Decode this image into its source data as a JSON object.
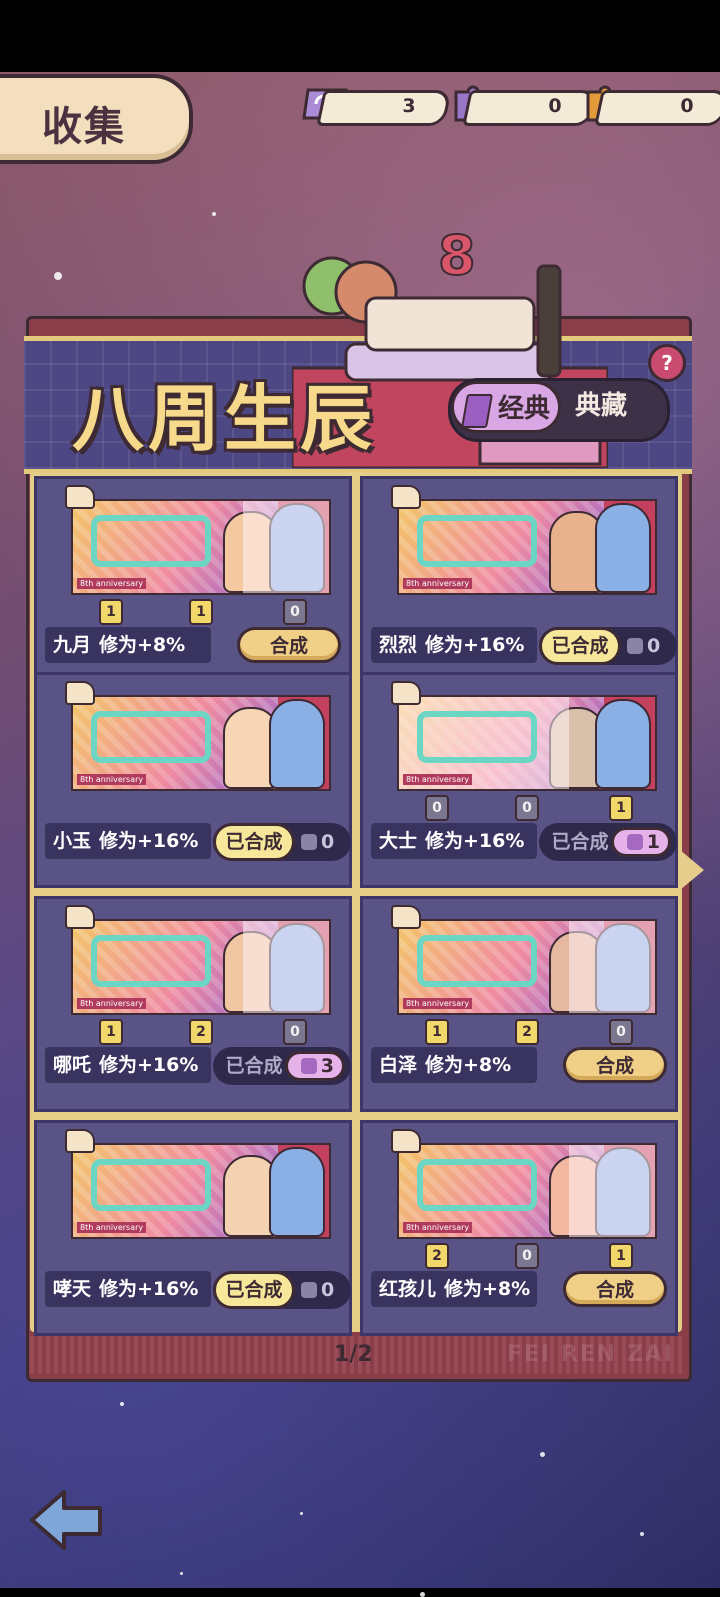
{
  "header": {
    "title": "收集",
    "currencies": [
      {
        "icon": "ticket-icon",
        "value": "3",
        "color": "#a98bd6"
      },
      {
        "icon": "purple-puzzle-icon",
        "value": "0",
        "color": "#9a76c9"
      },
      {
        "icon": "orange-puzzle-icon",
        "value": "0",
        "color": "#e39a3a"
      }
    ]
  },
  "banner": {
    "title": "八周生辰",
    "tabs": {
      "classic": "经典",
      "collection": "典藏"
    },
    "help": "?"
  },
  "cards": [
    {
      "name": "九月",
      "bonus": "修为+8%",
      "pieces": [
        "1",
        "1",
        "0"
      ],
      "state": "compose",
      "action": "合成"
    },
    {
      "name": "烈烈",
      "bonus": "修为+16%",
      "pieces": [],
      "state": "done",
      "action": "已合成",
      "fragments": "0"
    },
    {
      "name": "小玉",
      "bonus": "修为+16%",
      "pieces": [],
      "state": "done",
      "action": "已合成",
      "fragments": "0"
    },
    {
      "name": "大士",
      "bonus": "修为+16%",
      "pieces": [
        "0",
        "0",
        "1"
      ],
      "state": "done-dim",
      "action": "已合成",
      "fragments": "1"
    },
    {
      "name": "哪吒",
      "bonus": "修为+16%",
      "pieces": [
        "1",
        "2",
        "0"
      ],
      "state": "done-dim",
      "action": "已合成",
      "fragments": "3"
    },
    {
      "name": "白泽",
      "bonus": "修为+8%",
      "pieces": [
        "1",
        "2",
        "0"
      ],
      "state": "compose",
      "action": "合成"
    },
    {
      "name": "哮天",
      "bonus": "修为+16%",
      "pieces": [],
      "state": "done",
      "action": "已合成",
      "fragments": "0"
    },
    {
      "name": "红孩儿",
      "bonus": "修为+8%",
      "pieces": [
        "2",
        "0",
        "1"
      ],
      "state": "compose",
      "action": "合成"
    }
  ],
  "pager": {
    "page": "1/2",
    "watermark": "FEI REN ZAI"
  },
  "colors": {
    "accent": "#f0cf86",
    "panel": "#5a5486",
    "title": "#f6d98a"
  }
}
